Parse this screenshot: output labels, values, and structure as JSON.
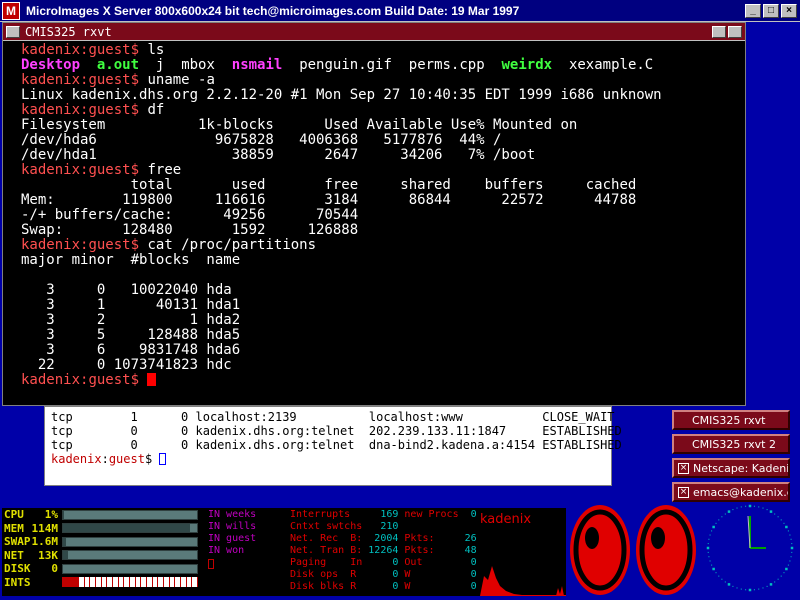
{
  "xserver": {
    "logo": "M",
    "title": "MicroImages X Server   800x600x24 bit   tech@microimages.com   Build Date: 19 Mar 1997"
  },
  "rxvt": {
    "title": "CMIS325 rxvt",
    "prompt_user": "kadenix",
    "prompt_host": "guest",
    "prompt_sep": ":",
    "prompt_end": "$ ",
    "commands": {
      "ls": "ls",
      "uname": "uname -a",
      "df": "df",
      "free": "free",
      "cat": "cat /proc/partitions"
    },
    "ls_output": [
      {
        "name": "Desktop",
        "type": "dir"
      },
      {
        "name": "a.out",
        "type": "exe"
      },
      {
        "name": "j",
        "type": "file"
      },
      {
        "name": "mbox",
        "type": "file"
      },
      {
        "name": "nsmail",
        "type": "dir"
      },
      {
        "name": "penguin.gif",
        "type": "file"
      },
      {
        "name": "perms.cpp",
        "type": "file"
      },
      {
        "name": "weirdx",
        "type": "exe"
      },
      {
        "name": "xexample.C",
        "type": "file"
      }
    ],
    "uname_output": "Linux kadenix.dhs.org 2.2.12-20 #1 Mon Sep 27 10:40:35 EDT 1999 i686 unknown",
    "df_output": [
      "Filesystem           1k-blocks      Used Available Use% Mounted on",
      "/dev/hda6              9675828   4006368   5177876  44% /",
      "/dev/hda1                38859      2647     34206   7% /boot"
    ],
    "free_output": [
      "             total       used       free     shared    buffers     cached",
      "Mem:        119800     116616       3184      86844      22572      44788",
      "-/+ buffers/cache:      49256      70544",
      "Swap:       128480       1592     126888"
    ],
    "partitions_output": [
      "major minor  #blocks  name",
      "",
      "   3     0   10022040 hda",
      "   3     1      40131 hda1",
      "   3     2          1 hda2",
      "   3     5     128488 hda5",
      "   3     6    9831748 hda6",
      "  22     0 1073741823 hdc"
    ]
  },
  "xterm2": {
    "lines": [
      "tcp        1      0 localhost:2139          localhost:www           CLOSE_WAIT",
      "tcp        0      0 kadenix.dhs.org:telnet  202.239.133.11:1847     ESTABLISHED",
      "tcp        0      0 kadenix.dhs.org:telnet  dna-bind2.kadena.a:4154 ESTABLISHED"
    ],
    "prompt_user": "kadenix",
    "prompt_host": "guest",
    "prompt_end": "$ "
  },
  "tasks": [
    {
      "label": "CMIS325 rxvt",
      "iconified": false
    },
    {
      "label": "CMIS325 rxvt 2",
      "iconified": false
    },
    {
      "label": "Netscape: Kadeni",
      "iconified": true
    },
    {
      "label": "emacs@kadenix.dh",
      "iconified": true
    }
  ],
  "monitor": {
    "rows": [
      {
        "label": "CPU",
        "value": "1%",
        "fill": 0.01
      },
      {
        "label": "MEM",
        "value": "114M",
        "fill": 0.95
      },
      {
        "label": "SWAP",
        "value": "1.6M",
        "fill": 0.02
      },
      {
        "label": "NET",
        "value": "13K",
        "fill": 0.04
      },
      {
        "label": "DISK",
        "value": "0",
        "fill": 0.0
      },
      {
        "label": "INTS",
        "value": "",
        "fill": 0
      }
    ]
  },
  "users": [
    "IN weeks",
    "IN wills",
    "IN guest",
    "IN won"
  ],
  "stats": {
    "rows": [
      [
        "Interrupts",
        "169",
        "new Procs",
        "0"
      ],
      [
        "Cntxt swtchs",
        "210",
        "",
        ""
      ],
      [
        "Net. Rec  B:",
        "2004",
        "Pkts:",
        "26"
      ],
      [
        "Net. Tran B:",
        "12264",
        "Pkts:",
        "48"
      ],
      [
        "Paging    In",
        "0",
        "Out",
        "0"
      ],
      [
        "Disk ops  R",
        "0",
        "W",
        "0"
      ],
      [
        "Disk blks R",
        "0",
        "W",
        "0"
      ]
    ]
  },
  "load": {
    "label": "kadenix"
  },
  "colors": {
    "titlebar": "#000080",
    "rxvt_title": "#7b0a1a",
    "desktop": "#0000a8",
    "prompt": "#ff5050"
  }
}
